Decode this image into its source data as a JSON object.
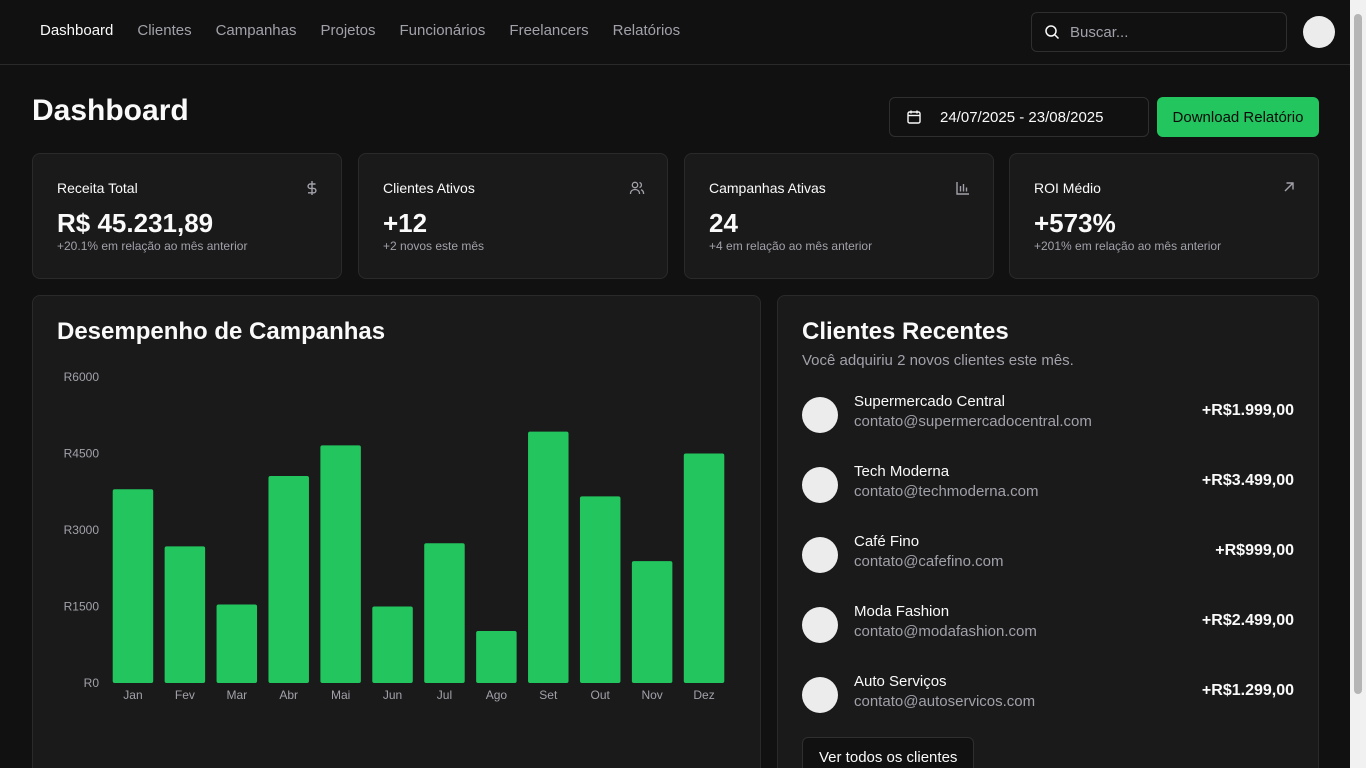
{
  "nav": {
    "items": [
      {
        "label": "Dashboard",
        "active": true
      },
      {
        "label": "Clientes",
        "active": false
      },
      {
        "label": "Campanhas",
        "active": false
      },
      {
        "label": "Projetos",
        "active": false
      },
      {
        "label": "Funcionários",
        "active": false
      },
      {
        "label": "Freelancers",
        "active": false
      },
      {
        "label": "Relatórios",
        "active": false
      }
    ],
    "search_placeholder": "Buscar..."
  },
  "header": {
    "title": "Dashboard",
    "date_range": "24/07/2025 - 23/08/2025",
    "download_label": "Download Relatório"
  },
  "stats": [
    {
      "title": "Receita Total",
      "value": "R$ 45.231,89",
      "sub": "+20.1% em relação ao mês anterior",
      "icon": "dollar-icon"
    },
    {
      "title": "Clientes Ativos",
      "value": "+12",
      "sub": "+2 novos este mês",
      "icon": "users-icon"
    },
    {
      "title": "Campanhas Ativas",
      "value": "24",
      "sub": "+4 em relação ao mês anterior",
      "icon": "bar-chart-icon"
    },
    {
      "title": "ROI Médio",
      "value": "+573%",
      "sub": "+201% em relação ao mês anterior",
      "icon": "arrow-up-right-icon"
    }
  ],
  "chart_card": {
    "title": "Desempenho de Campanhas"
  },
  "chart_data": {
    "type": "bar",
    "categories": [
      "Jan",
      "Fev",
      "Mar",
      "Abr",
      "Mai",
      "Jun",
      "Jul",
      "Ago",
      "Set",
      "Out",
      "Nov",
      "Dez"
    ],
    "values": [
      3800,
      2680,
      1540,
      4060,
      4660,
      1500,
      2740,
      1020,
      4930,
      3660,
      2390,
      4500
    ],
    "ytick_labels": [
      "R0",
      "R1500",
      "R3000",
      "R4500",
      "R6000"
    ],
    "yticks": [
      0,
      1500,
      3000,
      4500,
      6000
    ],
    "ylim": [
      0,
      6000
    ],
    "bar_color": "#22c55e",
    "grid": false
  },
  "clients": {
    "title": "Clientes Recentes",
    "subtitle": "Você adquiriu 2 novos clientes este mês.",
    "items": [
      {
        "name": "Supermercado Central",
        "email": "contato@supermercadocentral.com",
        "amount": "+R$1.999,00"
      },
      {
        "name": "Tech Moderna",
        "email": "contato@techmoderna.com",
        "amount": "+R$3.499,00"
      },
      {
        "name": "Café Fino",
        "email": "contato@cafefino.com",
        "amount": "+R$999,00"
      },
      {
        "name": "Moda Fashion",
        "email": "contato@modafashion.com",
        "amount": "+R$2.499,00"
      },
      {
        "name": "Auto Serviços",
        "email": "contato@autoservicos.com",
        "amount": "+R$1.299,00"
      }
    ],
    "see_all_label": "Ver todos os clientes"
  },
  "colors": {
    "accent": "#22c55e",
    "background": "#111111",
    "card": "#1a1a1a"
  }
}
